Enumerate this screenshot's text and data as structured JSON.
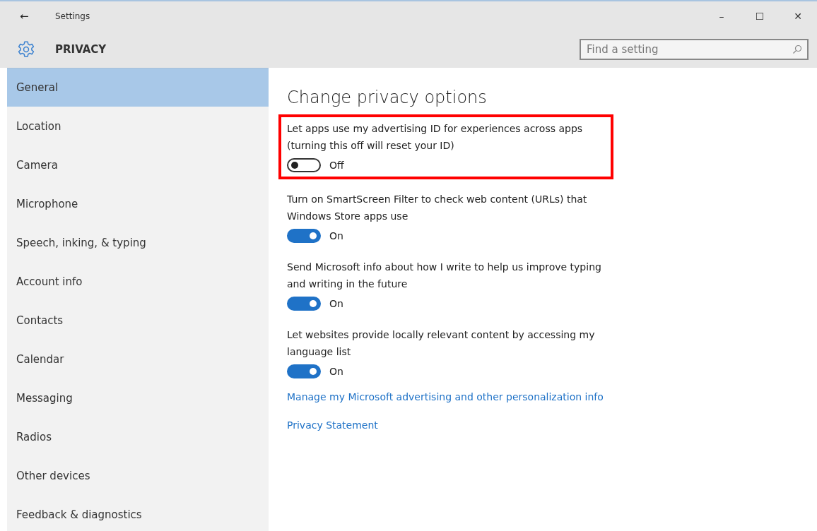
{
  "window": {
    "title": "Settings",
    "back": "←",
    "controls": [
      "–",
      "☐",
      "✕"
    ]
  },
  "header": {
    "title": "PRIVACY",
    "search": {
      "placeholder": "Find a setting"
    }
  },
  "sidebar": {
    "items": [
      {
        "label": "General",
        "selected": true
      },
      {
        "label": "Location",
        "selected": false
      },
      {
        "label": "Camera",
        "selected": false
      },
      {
        "label": "Microphone",
        "selected": false
      },
      {
        "label": "Speech, inking, & typing",
        "selected": false
      },
      {
        "label": "Account info",
        "selected": false
      },
      {
        "label": "Contacts",
        "selected": false
      },
      {
        "label": "Calendar",
        "selected": false
      },
      {
        "label": "Messaging",
        "selected": false
      },
      {
        "label": "Radios",
        "selected": false
      },
      {
        "label": "Other devices",
        "selected": false
      },
      {
        "label": "Feedback & diagnostics",
        "selected": false
      }
    ]
  },
  "content": {
    "heading": "Change privacy options",
    "options": [
      {
        "text": "Let apps use my advertising ID for experiences across apps (turning this off will reset your ID)",
        "on": false,
        "state_label": "Off",
        "highlighted": true
      },
      {
        "text": "Turn on SmartScreen Filter to check web content (URLs) that Windows Store apps use",
        "on": true,
        "state_label": "On",
        "highlighted": false
      },
      {
        "text": "Send Microsoft info about how I write to help us improve typing and writing in the future",
        "on": true,
        "state_label": "On",
        "highlighted": false
      },
      {
        "text": "Let websites provide locally relevant content by accessing my language list",
        "on": true,
        "state_label": "On",
        "highlighted": false
      }
    ],
    "links": [
      "Manage my Microsoft advertising and other personalization info",
      "Privacy Statement"
    ]
  }
}
